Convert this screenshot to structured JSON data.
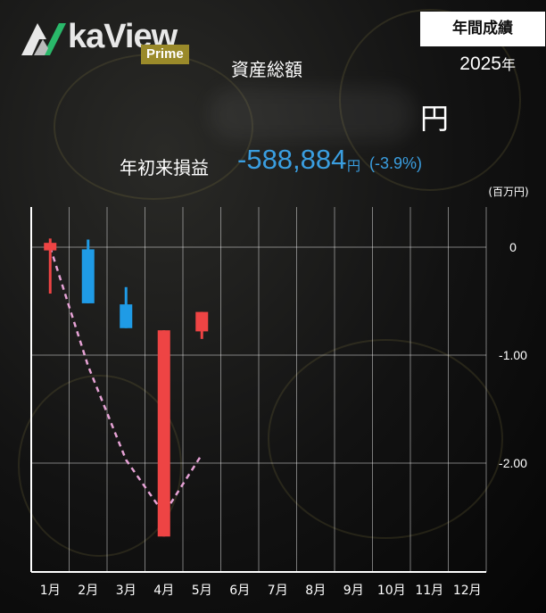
{
  "header": {
    "logo_text": "kaView",
    "logo_badge": "Prime",
    "badge": "年間成績",
    "year": "2025",
    "year_unit": "年",
    "assets_label": "資産総額",
    "assets_unit": "円",
    "ytd_label": "年初来損益",
    "ytd_value": "-588,884",
    "ytd_unit": "円",
    "ytd_pct": "(-3.9%)"
  },
  "colors": {
    "accent_blue": "#3a9ee0",
    "candle_up": "#ee4444",
    "candle_down": "#1f9be6",
    "trend_line": "#e7a3d6"
  },
  "chart_data": {
    "type": "candlestick",
    "unit_label": "(百万円)",
    "categories": [
      "1月",
      "2月",
      "3月",
      "4月",
      "5月",
      "6月",
      "7月",
      "8月",
      "9月",
      "10月",
      "11月",
      "12月"
    ],
    "ylim": [
      -2.7,
      0.3
    ],
    "yticks": [
      {
        "value": 0,
        "label": "0"
      },
      {
        "value": -1,
        "label": "-1.00"
      },
      {
        "value": -2,
        "label": "-2.00"
      }
    ],
    "candles": [
      {
        "month": "1月",
        "open": -0.03,
        "close": 0.04,
        "high": 0.08,
        "low": -0.43,
        "direction": "up"
      },
      {
        "month": "2月",
        "open": -0.02,
        "close": -0.52,
        "high": 0.07,
        "low": -0.52,
        "direction": "down"
      },
      {
        "month": "3月",
        "open": -0.53,
        "close": -0.75,
        "high": -0.37,
        "low": -0.75,
        "direction": "down"
      },
      {
        "month": "4月",
        "open": -2.68,
        "close": -0.77,
        "high": -0.77,
        "low": -2.68,
        "direction": "up"
      },
      {
        "month": "5月",
        "open": -0.78,
        "close": -0.6,
        "high": -0.6,
        "low": -0.85,
        "direction": "up"
      }
    ],
    "trend": [
      {
        "month": "1月",
        "value": 0.0
      },
      {
        "month": "2月",
        "value": -1.1
      },
      {
        "month": "3月",
        "value": -1.97
      },
      {
        "month": "4月",
        "value": -2.47
      },
      {
        "month": "5月",
        "value": -1.92
      }
    ],
    "grid": true
  }
}
